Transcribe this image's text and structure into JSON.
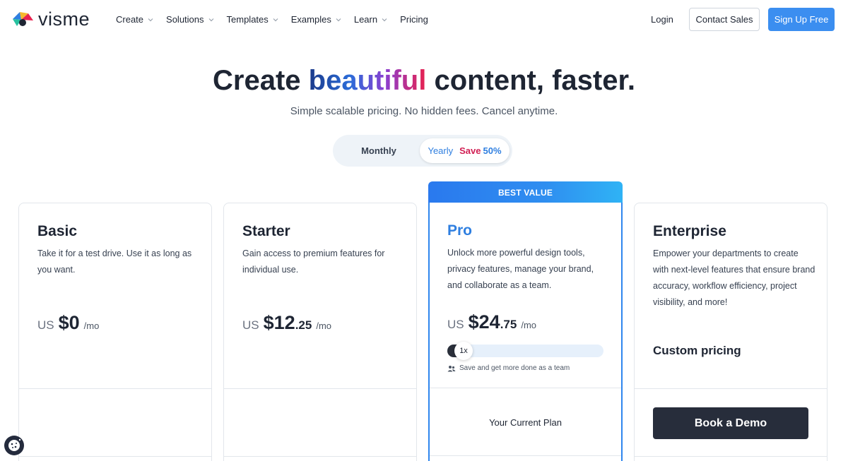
{
  "brand": {
    "name": "visme"
  },
  "nav": {
    "items": [
      {
        "label": "Create",
        "dropdown": true
      },
      {
        "label": "Solutions",
        "dropdown": true
      },
      {
        "label": "Templates",
        "dropdown": true
      },
      {
        "label": "Examples",
        "dropdown": true
      },
      {
        "label": "Learn",
        "dropdown": true
      },
      {
        "label": "Pricing",
        "dropdown": false
      }
    ],
    "login": "Login",
    "contact_sales": "Contact Sales",
    "sign_up": "Sign Up Free"
  },
  "hero": {
    "title_before": "Create ",
    "title_highlight": "beautiful",
    "title_after": " content, faster.",
    "subtitle": "Simple scalable pricing. No hidden fees. Cancel anytime."
  },
  "billing_toggle": {
    "monthly": "Monthly",
    "yearly": "Yearly",
    "save_word": "Save",
    "save_pct": "50%",
    "selected": "Yearly"
  },
  "plans": {
    "basic": {
      "name": "Basic",
      "description": "Take it for a test drive. Use it as long as you want.",
      "currency": "US",
      "price": "$0",
      "per": "/mo"
    },
    "starter": {
      "name": "Starter",
      "description": "Gain access to premium features for individual use.",
      "currency": "US",
      "price": "$12",
      "cents": ".25",
      "per": "/mo"
    },
    "pro": {
      "badge": "BEST VALUE",
      "name": "Pro",
      "description": "Unlock more powerful design tools, privacy features, manage your brand, and collaborate as a team.",
      "currency": "US",
      "price": "$24",
      "cents": ".75",
      "per": "/mo",
      "seats_label": "1x",
      "seats_level": 0,
      "team_note": "Save and get more done as a team",
      "current_plan": "Your Current Plan"
    },
    "enterprise": {
      "name": "Enterprise",
      "description": "Empower your departments to create with next-level features that ensure brand accuracy, workflow efficiency, project visibility, and more!",
      "custom_pricing": "Custom pricing",
      "cta": "Book a Demo"
    }
  },
  "colors": {
    "accent_blue": "#3b8ef0",
    "save_red": "#d11f53",
    "dark_button": "#272d3b"
  },
  "icons": [
    "visme-logo-icon",
    "chevron-down-icon",
    "team-icon",
    "cookie-icon"
  ]
}
